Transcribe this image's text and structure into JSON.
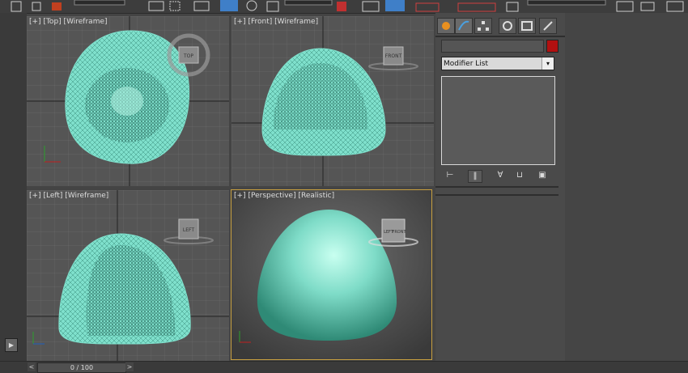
{
  "viewports": {
    "top": {
      "plus": "[+]",
      "name": "Top",
      "mode": "Wireframe",
      "cube": "TOP"
    },
    "front": {
      "plus": "[+]",
      "name": "Front",
      "mode": "Wireframe",
      "cube": "FRONT"
    },
    "left": {
      "plus": "[+]",
      "name": "Left",
      "mode": "Wireframe",
      "cube": "LEFT"
    },
    "perspective": {
      "plus": "[+]",
      "name": "Perspective",
      "mode": "Realistic",
      "cube_a": "LEFT",
      "cube_b": "FRONT"
    }
  },
  "command_panel": {
    "modifier_list": "Modifier List",
    "object_color": "#b21010",
    "tabs": [
      "create-icon",
      "modify-icon",
      "hierarchy-icon",
      "motion-icon",
      "display-icon",
      "utilities-icon"
    ]
  },
  "timeline": {
    "frame_counter": "0 / 100",
    "prev": "<",
    "next": ">"
  },
  "axis": {
    "x": "x",
    "y": "y",
    "z": "z"
  },
  "colors": {
    "mesh": "#7fe0cc",
    "mesh_dark": "#1a6a5a",
    "grid": "#7a7a7a",
    "active_border": "#c8a040",
    "shaded": "#7fdcc8"
  }
}
